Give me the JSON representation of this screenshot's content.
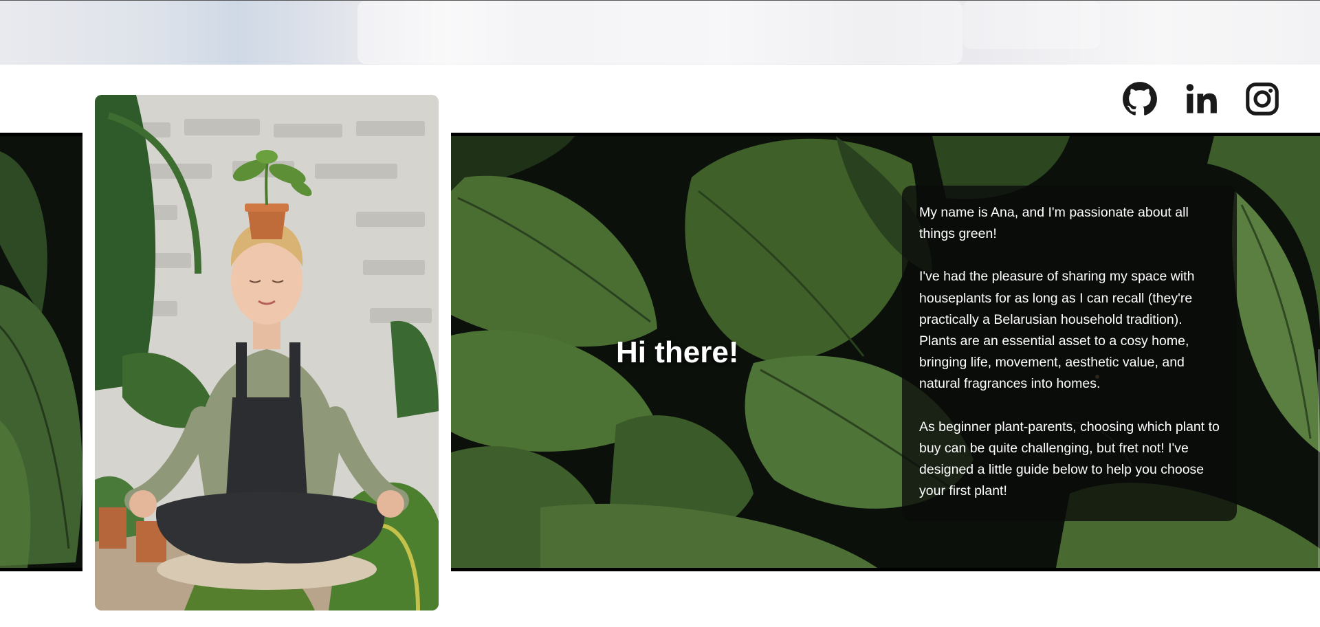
{
  "social_links": [
    {
      "name": "github-icon",
      "label": "GitHub"
    },
    {
      "name": "linkedin-icon",
      "label": "LinkedIn"
    },
    {
      "name": "instagram-icon",
      "label": "Instagram"
    }
  ],
  "hero": {
    "title": "Hi there!",
    "paragraphs": [
      "My name is Ana, and I'm passionate about all things green!",
      "I've had the pleasure of sharing my space with houseplants for as long as I can recall (they're practically a Belarusian household tradition). Plants are an essential asset to a cosy home, bringing life, movement, aesthetic value, and natural fragrances into homes.",
      "As beginner plant-parents, choosing which plant to buy can be quite challenging, but fret not! I've designed a little guide below to help you choose your first plant!"
    ]
  },
  "colors": {
    "icon": "#1a1a1a",
    "hero_text": "#ffffff",
    "leaf_dark": "#2f4a22",
    "leaf_light": "#6f8f4a"
  }
}
